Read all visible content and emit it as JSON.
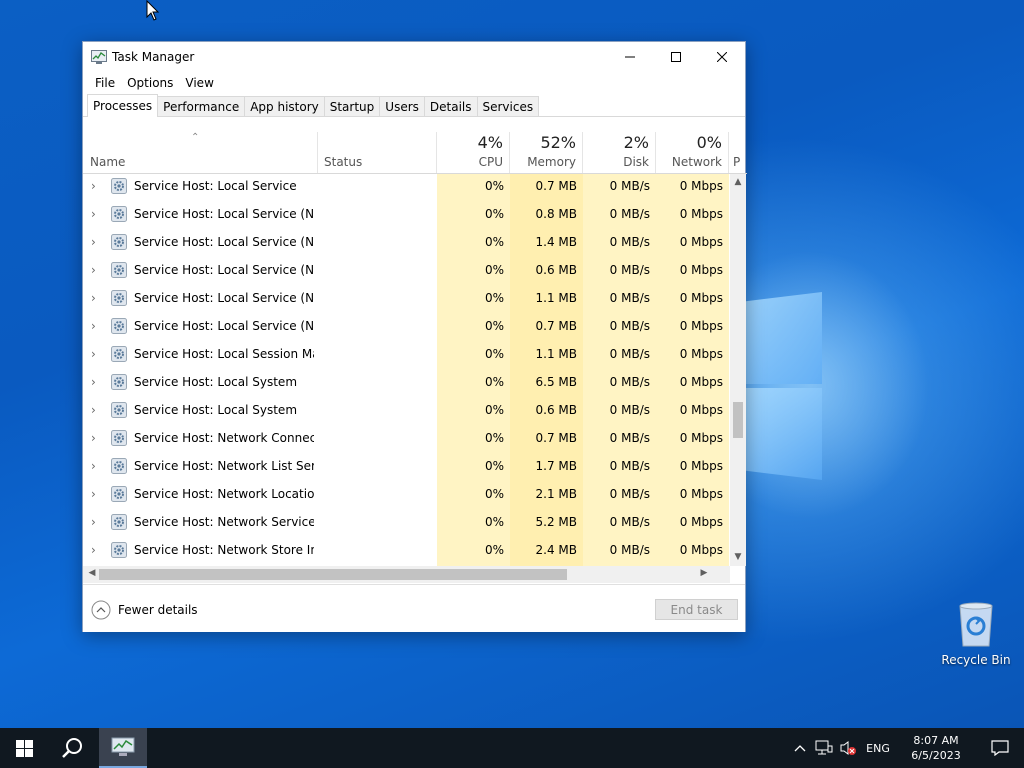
{
  "window": {
    "title": "Task Manager",
    "menu": [
      "File",
      "Options",
      "View"
    ],
    "tabs": [
      "Processes",
      "Performance",
      "App history",
      "Startup",
      "Users",
      "Details",
      "Services"
    ],
    "active_tab": "Processes"
  },
  "columns": {
    "name": "Name",
    "status": "Status",
    "cpu": {
      "pct": "4%",
      "label": "CPU"
    },
    "memory": {
      "pct": "52%",
      "label": "Memory"
    },
    "disk": {
      "pct": "2%",
      "label": "Disk"
    },
    "network": {
      "pct": "0%",
      "label": "Network"
    },
    "power_partial": "P"
  },
  "rows": [
    {
      "name": "Service Host: Local Service",
      "cpu": "0%",
      "mem": "0.7 MB",
      "disk": "0 MB/s",
      "net": "0 Mbps"
    },
    {
      "name": "Service Host: Local Service (Net...",
      "cpu": "0%",
      "mem": "0.8 MB",
      "disk": "0 MB/s",
      "net": "0 Mbps"
    },
    {
      "name": "Service Host: Local Service (Net...",
      "cpu": "0%",
      "mem": "1.4 MB",
      "disk": "0 MB/s",
      "net": "0 Mbps"
    },
    {
      "name": "Service Host: Local Service (Net...",
      "cpu": "0%",
      "mem": "0.6 MB",
      "disk": "0 MB/s",
      "net": "0 Mbps"
    },
    {
      "name": "Service Host: Local Service (Net...",
      "cpu": "0%",
      "mem": "1.1 MB",
      "disk": "0 MB/s",
      "net": "0 Mbps"
    },
    {
      "name": "Service Host: Local Service (No ...",
      "cpu": "0%",
      "mem": "0.7 MB",
      "disk": "0 MB/s",
      "net": "0 Mbps"
    },
    {
      "name": "Service Host: Local Session Man...",
      "cpu": "0%",
      "mem": "1.1 MB",
      "disk": "0 MB/s",
      "net": "0 Mbps"
    },
    {
      "name": "Service Host: Local System",
      "cpu": "0%",
      "mem": "6.5 MB",
      "disk": "0 MB/s",
      "net": "0 Mbps"
    },
    {
      "name": "Service Host: Local System",
      "cpu": "0%",
      "mem": "0.6 MB",
      "disk": "0 MB/s",
      "net": "0 Mbps"
    },
    {
      "name": "Service Host: Network Connecti...",
      "cpu": "0%",
      "mem": "0.7 MB",
      "disk": "0 MB/s",
      "net": "0 Mbps"
    },
    {
      "name": "Service Host: Network List Service",
      "cpu": "0%",
      "mem": "1.7 MB",
      "disk": "0 MB/s",
      "net": "0 Mbps"
    },
    {
      "name": "Service Host: Network Location ...",
      "cpu": "0%",
      "mem": "2.1 MB",
      "disk": "0 MB/s",
      "net": "0 Mbps"
    },
    {
      "name": "Service Host: Network Service",
      "cpu": "0%",
      "mem": "5.2 MB",
      "disk": "0 MB/s",
      "net": "0 Mbps"
    },
    {
      "name": "Service Host: Network Store Inte...",
      "cpu": "0%",
      "mem": "2.4 MB",
      "disk": "0 MB/s",
      "net": "0 Mbps"
    }
  ],
  "footer": {
    "fewer_details": "Fewer details",
    "end_task": "End task"
  },
  "desktop": {
    "recycle_bin": "Recycle Bin"
  },
  "taskbar": {
    "lang": "ENG",
    "time": "8:07 AM",
    "date": "6/5/2023"
  },
  "icons": {
    "row_icon": "gear-service-icon",
    "app_icon": "task-manager-icon"
  }
}
